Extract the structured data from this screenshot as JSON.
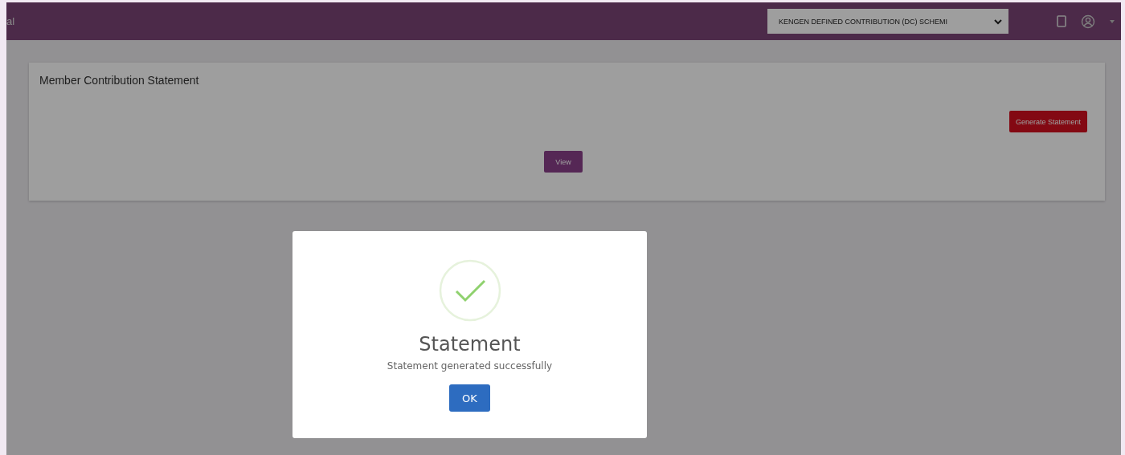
{
  "header": {
    "brand_fragment": "al",
    "scheme_select": {
      "value": "KENGEN DEFINED CONTRIBUTION (DC) SCHEMI"
    }
  },
  "card": {
    "title": "Member Contribution Statement",
    "buttons": [
      {
        "kind": "generate",
        "label": "Generate Statement"
      },
      {
        "kind": "view",
        "label": "View"
      }
    ]
  },
  "dialog": {
    "title": "Statement",
    "message": "Statement generated successfully",
    "button": "OK"
  }
}
